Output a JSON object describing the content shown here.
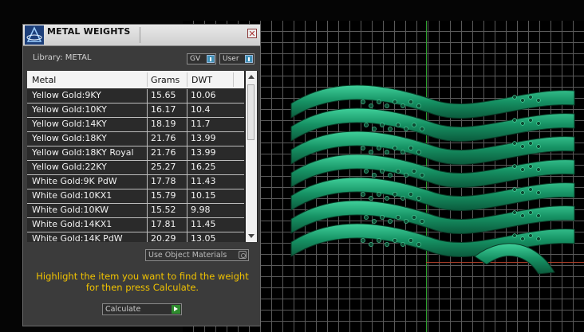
{
  "panel": {
    "title": "METAL WEIGHTS",
    "library_label": "Library: METAL",
    "gv_label": "GV",
    "user_label": "User",
    "close_glyph": "✕"
  },
  "table": {
    "headers": [
      "Metal",
      "Grams",
      "DWT"
    ],
    "rows": [
      [
        "Yellow Gold:9KY",
        "15.65",
        "10.06"
      ],
      [
        "Yellow Gold:10KY",
        "16.17",
        "10.4"
      ],
      [
        "Yellow Gold:14KY",
        "18.19",
        "11.7"
      ],
      [
        "Yellow Gold:18KY",
        "21.76",
        "13.99"
      ],
      [
        "Yellow Gold:18KY Royal",
        "21.76",
        "13.99"
      ],
      [
        "Yellow Gold:22KY",
        "25.27",
        "16.25"
      ],
      [
        "White Gold:9K PdW",
        "17.78",
        "11.43"
      ],
      [
        "White Gold:10KX1",
        "15.79",
        "10.15"
      ],
      [
        "White Gold:10KW",
        "15.52",
        "9.98"
      ],
      [
        "White Gold:14KX1",
        "17.81",
        "11.45"
      ],
      [
        "White Gold:14K PdW",
        "20.29",
        "13.05"
      ]
    ]
  },
  "use_object_materials_label": "Use Object Materials",
  "instruction": "Highlight the item you want to find the weight for then press Calculate.",
  "calculate_label": "Calculate",
  "colors": {
    "accent_yellow": "#f0c200",
    "model_green": "#1a9a6a",
    "grid": "#5a5a5a"
  }
}
